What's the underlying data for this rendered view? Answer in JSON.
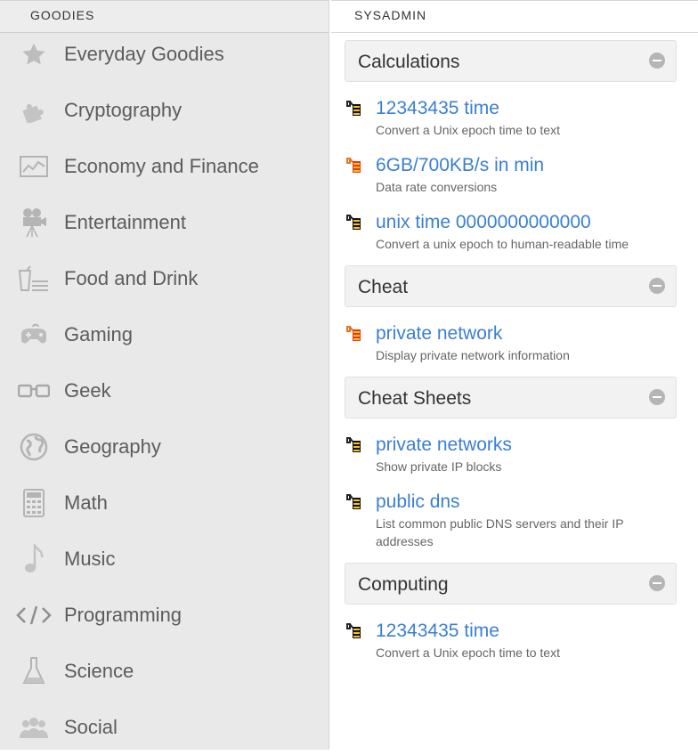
{
  "sidebar": {
    "header": "GOODIES",
    "items": [
      {
        "label": "Everyday Goodies",
        "icon": "star-icon"
      },
      {
        "label": "Cryptography",
        "icon": "puzzle-icon"
      },
      {
        "label": "Economy and Finance",
        "icon": "chart-icon"
      },
      {
        "label": "Entertainment",
        "icon": "film-camera-icon"
      },
      {
        "label": "Food and Drink",
        "icon": "food-drink-icon"
      },
      {
        "label": "Gaming",
        "icon": "gamepad-icon"
      },
      {
        "label": "Geek",
        "icon": "glasses-icon"
      },
      {
        "label": "Geography",
        "icon": "globe-icon"
      },
      {
        "label": "Math",
        "icon": "calculator-icon"
      },
      {
        "label": "Music",
        "icon": "music-note-icon"
      },
      {
        "label": "Programming",
        "icon": "code-icon"
      },
      {
        "label": "Science",
        "icon": "flask-icon"
      },
      {
        "label": "Social",
        "icon": "people-icon"
      }
    ]
  },
  "main": {
    "header": "SYSADMIN",
    "sections": [
      {
        "title": "Calculations",
        "entries": [
          {
            "title": "12343435 time",
            "desc": "Convert a Unix epoch time to text"
          },
          {
            "title": "6GB/700KB/s in min",
            "desc": "Data rate conversions"
          },
          {
            "title": "unix time 0000000000000",
            "desc": "Convert a unix epoch to human-readable time"
          }
        ]
      },
      {
        "title": "Cheat",
        "entries": [
          {
            "title": "private network",
            "desc": "Display private network information"
          }
        ]
      },
      {
        "title": "Cheat Sheets",
        "entries": [
          {
            "title": "private networks",
            "desc": "Show private IP blocks"
          },
          {
            "title": "public dns",
            "desc": "List common public DNS servers and their IP addresses"
          }
        ]
      },
      {
        "title": "Computing",
        "entries": [
          {
            "title": "12343435 time",
            "desc": "Convert a Unix epoch time to text"
          }
        ]
      }
    ]
  },
  "colors": {
    "link": "#3a7fd4",
    "sidebar_bg": "#e9e9e9",
    "icon_gray": "#b4b4b4"
  }
}
